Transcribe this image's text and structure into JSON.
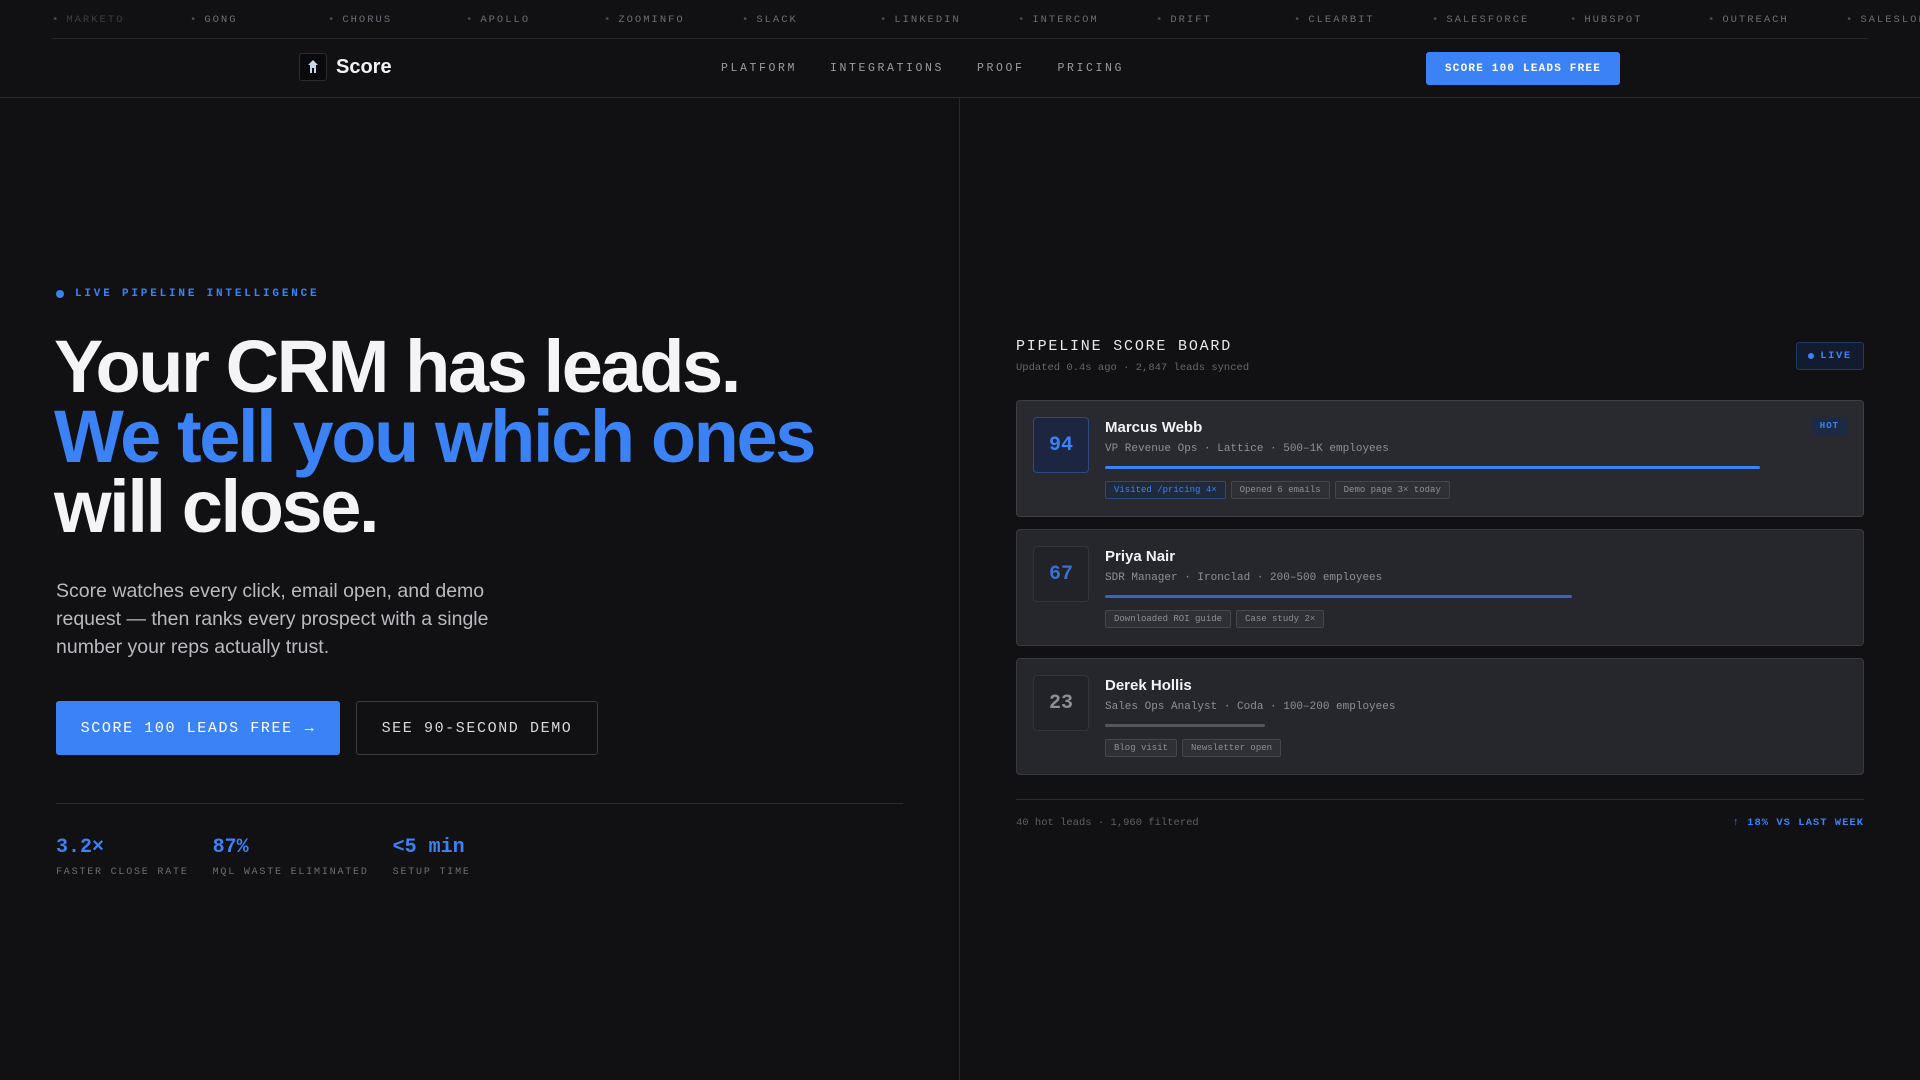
{
  "ticker": [
    "MARKETO",
    "GONG",
    "CHORUS",
    "APOLLO",
    "ZOOMINFO",
    "SLACK",
    "LINKEDIN",
    "INTERCOM",
    "DRIFT",
    "CLEARBIT",
    "SALESFORCE",
    "HUBSPOT",
    "OUTREACH",
    "SALESLOFT"
  ],
  "nav": {
    "brand": "Score",
    "links": [
      "PLATFORM",
      "INTEGRATIONS",
      "PROOF",
      "PRICING"
    ],
    "cta": "SCORE 100 LEADS FREE"
  },
  "hero": {
    "eyebrow": "LIVE PIPELINE INTELLIGENCE",
    "headline_1": "Your CRM has leads.",
    "headline_2": "We tell you which ones",
    "headline_3": "will close.",
    "subcopy": "Score watches every click, email open, and demo request — then ranks every prospect with a single number your reps actually trust.",
    "primary_cta": "SCORE 100 LEADS FREE",
    "primary_cta_arrow": "→",
    "secondary_cta": "SEE 90-SECOND DEMO",
    "stats": [
      {
        "value": "3.2×",
        "label": "FASTER CLOSE RATE"
      },
      {
        "value": "87%",
        "label": "MQL WASTE ELIMINATED"
      },
      {
        "value": "<5 min",
        "label": "SETUP TIME"
      }
    ]
  },
  "board": {
    "title": "PIPELINE SCORE BOARD",
    "subtitle": "Updated 0.4s ago · 2,847 leads synced",
    "live_label": "LIVE",
    "leads": [
      {
        "score": "94",
        "name": "Marcus Webb",
        "meta": "VP Revenue Ops · Lattice · 500–1K employees",
        "score_fraction": 0.94,
        "badge": "HOT",
        "tags": [
          "Visited /pricing 4×",
          "Opened 6 emails",
          "Demo page 3× today"
        ],
        "tier": "hot"
      },
      {
        "score": "67",
        "name": "Priya Nair",
        "meta": "SDR Manager · Ironclad · 200–500 employees",
        "score_fraction": 0.67,
        "badge": "",
        "tags": [
          "Downloaded ROI guide",
          "Case study 2×"
        ],
        "tier": "warm"
      },
      {
        "score": "23",
        "name": "Derek Hollis",
        "meta": "Sales Ops Analyst · Coda · 100–200 employees",
        "score_fraction": 0.23,
        "badge": "",
        "tags": [
          "Blog visit",
          "Newsletter open"
        ],
        "tier": "cold"
      }
    ],
    "footer_left": "40 hot leads · 1,960 filtered",
    "footer_right": "↑ 18% VS LAST WEEK"
  },
  "colors": {
    "accent": "#3b82f6",
    "background": "#111113",
    "warm_bar": "#3566c4",
    "cold_bar": "#55565c"
  }
}
